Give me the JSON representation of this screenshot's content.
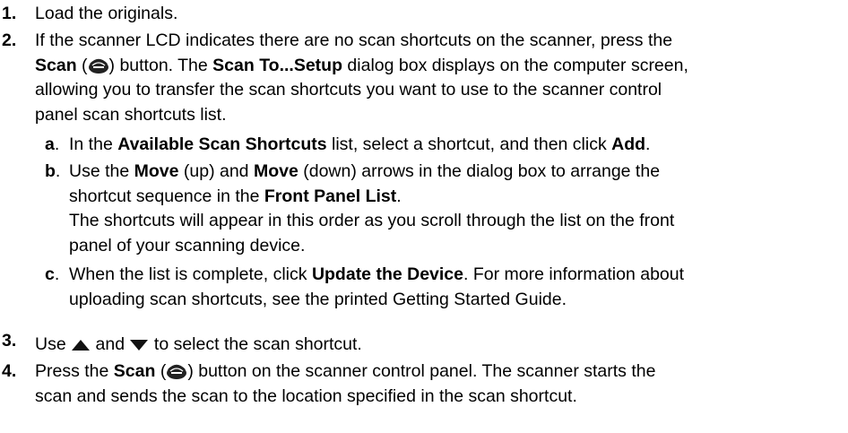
{
  "steps": [
    {
      "num": "1.",
      "text": "Load the originals."
    },
    {
      "num": "2.",
      "l1_a": "If the scanner LCD indicates there are no scan shortcuts on the scanner, press the",
      "l2_scan": "Scan",
      "l2_b": " (",
      "l2_c": ") button. The ",
      "l2_setup": "Scan To...Setup",
      "l2_d": " dialog box displays on the computer screen,",
      "l3": "allowing you to transfer the scan shortcuts you want to use to the scanner control",
      "l4": "panel scan shortcuts list."
    },
    {
      "num": "3.",
      "a": "Use ",
      "b": " and ",
      "c": " to select the scan shortcut."
    },
    {
      "num": "4.",
      "a": "Press the ",
      "scan": "Scan",
      "b": " (",
      "c": ") button on the scanner control panel. The scanner starts the",
      "l2": "scan and sends the scan to the location specified in the scan shortcut."
    }
  ],
  "substeps": [
    {
      "letter": "a",
      "dot": ".",
      "a": "In the ",
      "bold1": "Available Scan Shortcuts",
      "b": " list, select a shortcut, and then click ",
      "bold2": "Add",
      "c": "."
    },
    {
      "letter": "b",
      "dot": ".",
      "a": "Use the ",
      "bold1": "Move",
      "b": " (up) and ",
      "bold2": "Move",
      "c": " (down) arrows in the dialog box to arrange the",
      "l2a": "shortcut sequence in the ",
      "l2bold": "Front Panel List",
      "l2b": ".",
      "l3": "The shortcuts will appear in this order as you scroll through the list on the front",
      "l4": "panel of your scanning device."
    },
    {
      "letter": "c",
      "dot": ".",
      "a": "When the list is complete, click ",
      "bold1": "Update the Device",
      "b": ". For more information about",
      "l2": "uploading scan shortcuts, see the printed Getting Started Guide."
    }
  ],
  "icons": {
    "scan": "scanner-icon",
    "up": "up-arrow-icon",
    "down": "down-arrow-icon"
  },
  "colors": {
    "text": "#000000",
    "background": "#ffffff"
  }
}
